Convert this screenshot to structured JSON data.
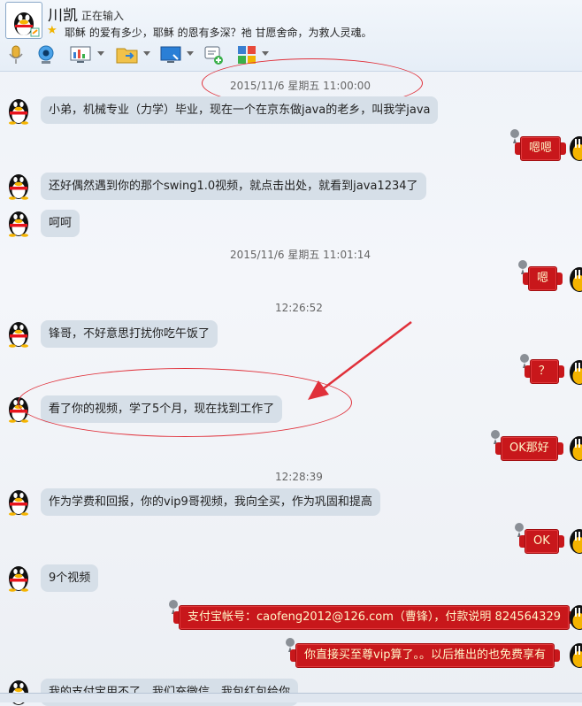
{
  "header": {
    "name": "川凯",
    "status": "正在输入",
    "signature": "耶稣 的爱有多少，耶稣 的恩有多深？祂 甘愿舍命，为救人灵魂。"
  },
  "toolbar": {
    "icons": [
      "mic-icon",
      "video-call-icon",
      "screen-share-icon",
      "send-file-icon",
      "remote-desktop-icon",
      "add-app-icon",
      "apps-grid-icon"
    ]
  },
  "timestamps": {
    "t1": "2015/11/6 星期五 11:00:00",
    "t2": "2015/11/6 星期五 11:01:14",
    "t3": "12:26:52",
    "t4": "12:28:39"
  },
  "messages": {
    "m1": "小弟，机械专业（力学）毕业，现在一个在京东做java的老乡，叫我学java",
    "r1": "嗯嗯",
    "m2": "还好偶然遇到你的那个swing1.0视频，就点击出处，就看到java1234了",
    "m3": "呵呵",
    "r2": "嗯",
    "m4": "锋哥，不好意思打扰你吃午饭了",
    "r3": "？",
    "m5": "看了你的视频，学了5个月，现在找到工作了",
    "r4": "OK那好",
    "m6": "作为学费和回报，你的vip9哥视频，我向全买，作为巩固和提高",
    "r5": "OK",
    "m7": "9个视频",
    "r6": "支付宝帐号：caofeng2012@126.com（曹锋），付款说明 824564329",
    "r7": "你直接买至尊vip算了。。以后推出的也免费享有",
    "m8": "我的支付宝用不了，我们充微信，我包红包给你"
  },
  "colors": {
    "accent_red": "#c8171b",
    "bubble_left": "#d6dfe8",
    "annotation": "#e0303a"
  }
}
